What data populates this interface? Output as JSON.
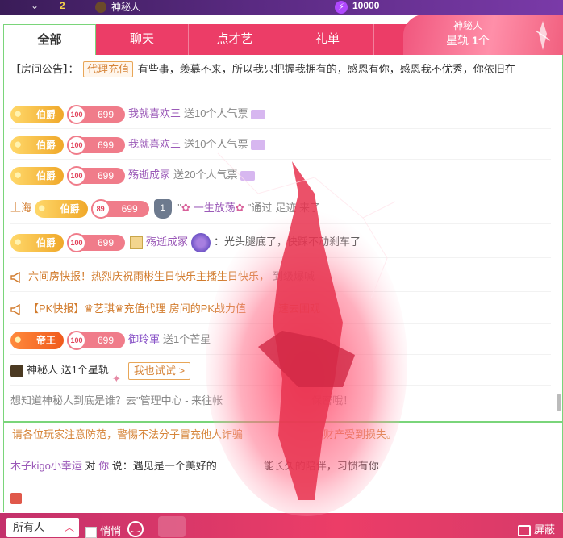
{
  "top": {
    "rank": "2",
    "nickname": "神秘人",
    "coins": "10000"
  },
  "tabs": [
    "全部",
    "聊天",
    "点才艺",
    "礼单"
  ],
  "gift_card": {
    "title": "神秘人",
    "prefix": "星轨 ",
    "count": "1",
    "suffix": "个"
  },
  "notice": {
    "label": "【房间公告】：",
    "tag": "代理充值",
    "text": "有些事，羡慕不来，所以我只把握我拥有的，感恩有你，感恩我不优秀，你依旧在"
  },
  "rows": [
    {
      "rank": "伯爵",
      "lv": "100",
      "score": "699",
      "user": "我就喜欢三",
      "action": "送10个人气票"
    },
    {
      "rank": "伯爵",
      "lv": "100",
      "score": "699",
      "user": "我就喜欢三",
      "action": "送10个人气票"
    },
    {
      "rank": "伯爵",
      "lv": "100",
      "score": "699",
      "user": "殇逝成冢",
      "action": "送20个人气票"
    }
  ],
  "enter": {
    "city": "上海",
    "rank": "伯爵",
    "lv": "89",
    "score": "699",
    "shield_num": "1",
    "user": "一生放荡",
    "text_a": "\"",
    "text_b": "\"通过",
    "text_c": "足迹 来了"
  },
  "row5": {
    "rank": "伯爵",
    "lv": "100",
    "score": "699",
    "user": "殇逝成冢",
    "text": "：光头腿底了，快踩不动刹车了"
  },
  "broadcast1": {
    "text": "六间房快报！热烈庆祝雨彬生日快乐主播生日快乐，",
    "tail": "到级爆喊"
  },
  "broadcast2": {
    "label": "【PK快报】",
    "user1": "艺琪",
    "user2": "充值代理",
    "text": "房间的PK战力值",
    "tail": "速去围观"
  },
  "row_emperor": {
    "rank": "帝王",
    "lv": "100",
    "score": "699",
    "user": "御玲軍",
    "action": "送1个芒星"
  },
  "mystery": {
    "text": "神秘人 送1个星轨",
    "button": "我也试试 >"
  },
  "hint": "想知道神秘人到底是谁？去\"管理中心 - 来往帐",
  "hint_tail": "保密哦！",
  "warning": "请各位玩家注意防范，警惕不法分子冒充他人诈骗",
  "warning_tail": "财产受到损失。",
  "talk": {
    "speaker": "木子kigo小幸运",
    "to": "对",
    "target": "你",
    "said": "说：",
    "text": "遇见是一个美好的",
    "tail": "能长久的陪伴，习惯有你"
  },
  "bottom": {
    "select": "所有人",
    "whisper": "悄悄",
    "block": "屏蔽"
  }
}
